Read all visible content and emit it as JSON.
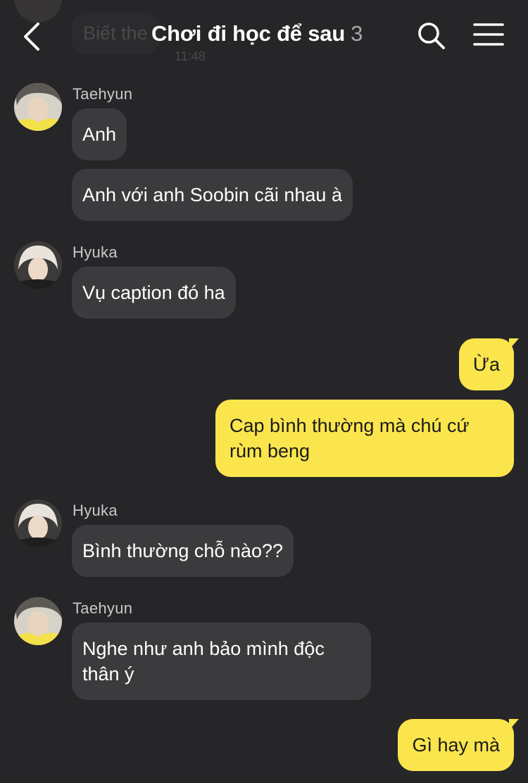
{
  "header": {
    "title": "Chơi đi học để sau",
    "member_count": "3",
    "back_icon": "chevron-left-icon",
    "search_icon": "search-icon",
    "menu_icon": "hamburger-menu-icon"
  },
  "previous_message": {
    "text": "Biết the",
    "time": "11:48"
  },
  "messages": [
    {
      "sender": "Taehyun",
      "direction": "incoming",
      "text": "Anh"
    },
    {
      "sender": "Taehyun",
      "direction": "incoming",
      "text": "Anh với anh Soobin cãi nhau à"
    },
    {
      "sender": "Hyuka",
      "direction": "incoming",
      "text": "Vụ caption đó ha"
    },
    {
      "sender": "",
      "direction": "outgoing",
      "text": "Ừa"
    },
    {
      "sender": "",
      "direction": "outgoing",
      "text": "Cap bình thường mà chú cứ rùm beng"
    },
    {
      "sender": "Hyuka",
      "direction": "incoming",
      "text": "Bình thường chỗ nào??"
    },
    {
      "sender": "Taehyun",
      "direction": "incoming",
      "text": "Nghe như anh bảo mình độc thân ý"
    },
    {
      "sender": "",
      "direction": "outgoing",
      "text": "Gì hay mà"
    }
  ],
  "colors": {
    "background": "#262628",
    "incoming_bubble": "#3b3b3e",
    "outgoing_bubble": "#fbe54d",
    "sender_name": "#c9c9cb",
    "count": "#a8a8aa"
  }
}
